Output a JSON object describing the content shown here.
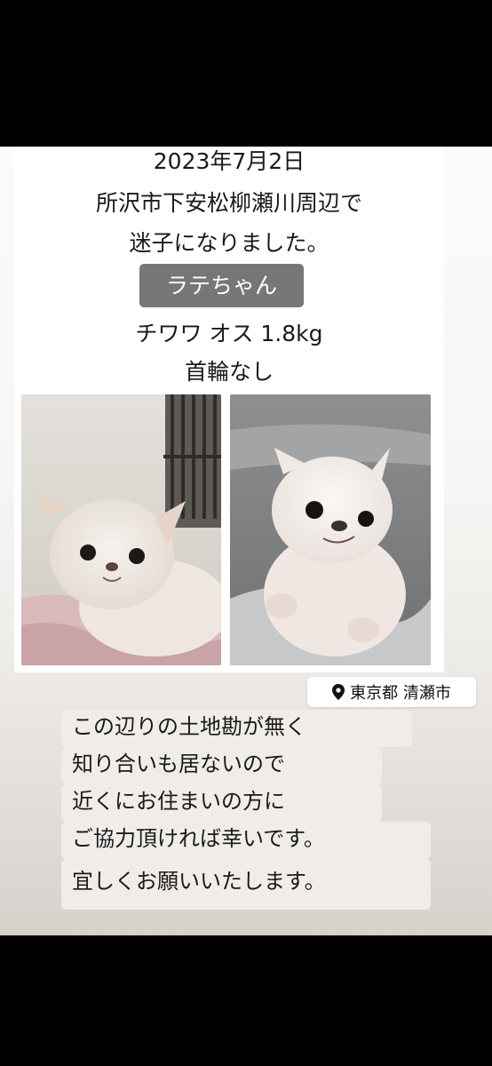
{
  "poster": {
    "date": "2023年7月2日",
    "place": "所沢市下安松柳瀬川周辺で",
    "status": "迷子になりました。",
    "dog_name": "ラテちゃん",
    "details": "チワワ オス 1.8kg",
    "collar": "首輪なし"
  },
  "location": {
    "label": "東京都 清瀬市",
    "icon": "location-pin-icon"
  },
  "message": {
    "lines": [
      "この辺りの土地勘が無く",
      "知り合いも居ないので",
      "近くにお住まいの方に",
      "ご協力頂ければ幸いです。",
      "宜しくお願いいたします。"
    ]
  },
  "photos": [
    {
      "name": "dog-photo-1",
      "subject": "white chihuahua on pink blanket"
    },
    {
      "name": "dog-photo-2",
      "subject": "white chihuahua on grey sofa"
    }
  ],
  "colors": {
    "chip_bg": "#777777",
    "background_top": "#fbfbfa",
    "background_bottom": "#d6d1cb",
    "message_bg": "#f0ede9"
  }
}
